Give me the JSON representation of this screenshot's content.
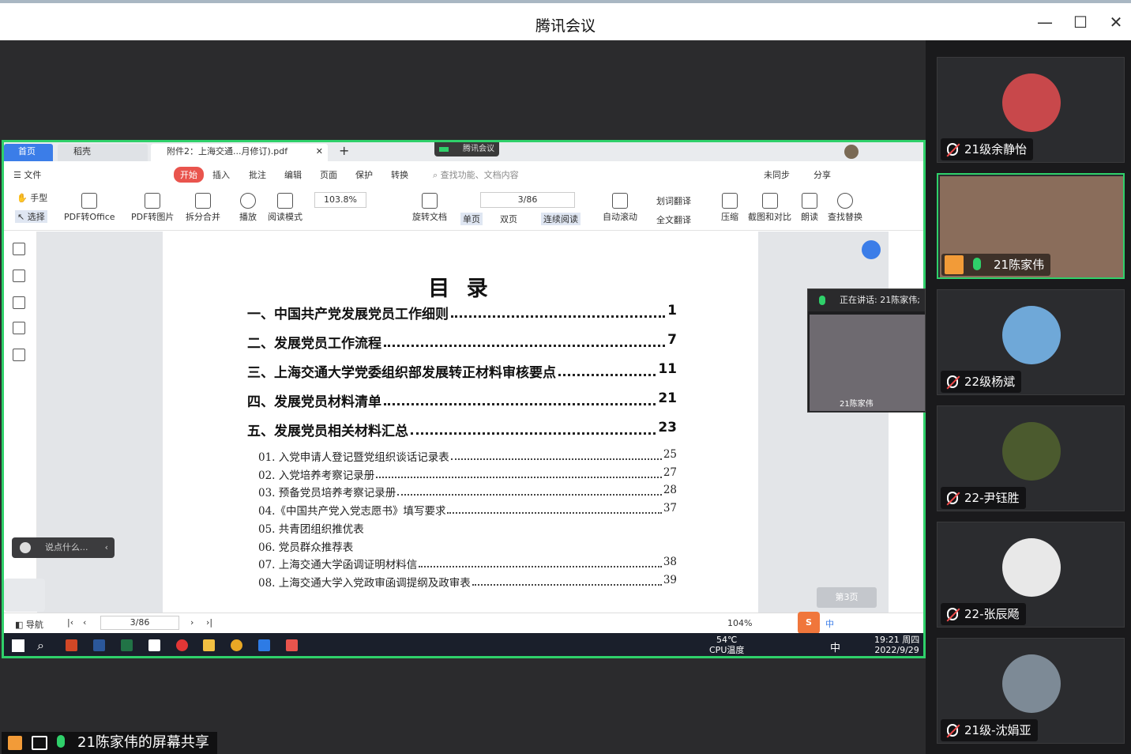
{
  "window": {
    "title": "腾讯会议",
    "minimize": "—",
    "maximize": "☐",
    "close": "✕"
  },
  "wps": {
    "tabs": {
      "home": "首页",
      "daoke": "稻壳",
      "pdf": "附件2：上海交通...月修订).pdf"
    },
    "meeting_badge": "腾讯会议",
    "menu": {
      "file": "文件",
      "start": "开始",
      "insert": "插入",
      "annotate": "批注",
      "edit": "编辑",
      "page": "页面",
      "protect": "保护",
      "convert": "转换",
      "search_placeholder": "查找功能、文档内容",
      "sync": "未同步",
      "share": "分享"
    },
    "tools": {
      "hand": "手型",
      "select": "选择",
      "pdf2office": "PDF转Office",
      "pdf2img": "PDF转图片",
      "split": "拆分合并",
      "play": "播放",
      "read_mode": "阅读模式",
      "zoom": "103.8%",
      "page": "3/86",
      "rotate": "旋转文档",
      "single": "单页",
      "double": "双页",
      "continuous": "连续阅读",
      "autoscroll": "自动滚动",
      "word_translate": "划词翻译",
      "full_translate": "全文翻译",
      "compress": "压缩",
      "screenshot": "截图和对比",
      "read_aloud": "朗读",
      "find_replace": "查找替换"
    },
    "doc": {
      "title": "目 录",
      "toc": [
        {
          "text": "一、中国共产党发展党员工作细则",
          "page": "1"
        },
        {
          "text": "二、发展党员工作流程",
          "page": "7"
        },
        {
          "text": "三、上海交通大学党委组织部发展转正材料审核要点 ",
          "page": "11"
        },
        {
          "text": "四、发展党员材料清单 ",
          "page": "21"
        },
        {
          "text": "五、发展党员相关材料汇总 ",
          "page": "23"
        }
      ],
      "sub": [
        {
          "text": "01. 入党申请人登记暨党组织谈话记录表",
          "page": "25"
        },
        {
          "text": "02. 入党培养考察记录册",
          "page": "27"
        },
        {
          "text": "03. 预备党员培养考察记录册",
          "page": "28"
        },
        {
          "text": "04.《中国共产党入党志愿书》填写要求",
          "page": "37"
        },
        {
          "text": "05.  共青团组织推优表",
          "page": ""
        },
        {
          "text": "06.  党员群众推荐表",
          "page": ""
        },
        {
          "text": "07. 上海交通大学函调证明材料信",
          "page": "38"
        },
        {
          "text": "08. 上海交通大学入党政审函调提纲及政审表",
          "page": "39"
        }
      ]
    },
    "chat_placeholder": "说点什么...",
    "page_badge": "第3页",
    "status": {
      "nav": "导航",
      "page": "3/86",
      "zoom": "104%",
      "ime": "中"
    },
    "taskbar": {
      "cpu_temp": "54℃",
      "cpu_label": "CPU温度",
      "ime": "中",
      "time": "19:21 周四",
      "date": "2022/9/29"
    }
  },
  "speaking": {
    "label": "正在讲话: 21陈家伟;",
    "name": "21陈家伟"
  },
  "participants": [
    {
      "name": "21级余静怡",
      "muted": true,
      "color": "#c8484b"
    },
    {
      "name": "21陈家伟",
      "muted": false,
      "color": "#8a6d5b"
    },
    {
      "name": "22级杨斌",
      "muted": true,
      "color": "#6fa8d8"
    },
    {
      "name": "22-尹钰胜",
      "muted": true,
      "color": "#4b5a2e"
    },
    {
      "name": "22-张辰飏",
      "muted": true,
      "color": "#e8e8e8"
    },
    {
      "name": "21级-沈娟亚",
      "muted": true,
      "color": "#7d8a96"
    }
  ],
  "share_label": "21陈家伟的屏幕共享"
}
